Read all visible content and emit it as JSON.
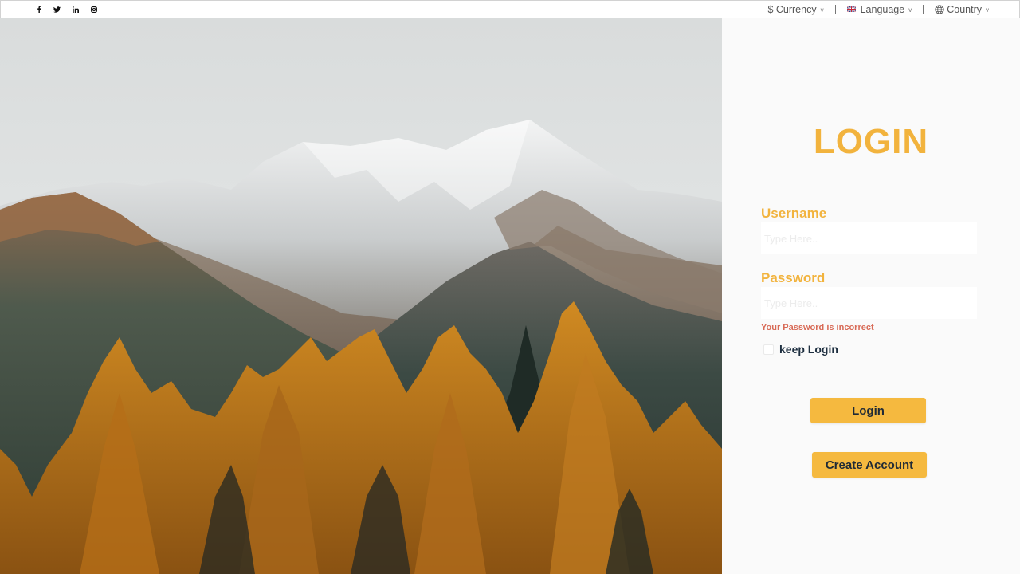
{
  "topbar": {
    "social": [
      {
        "name": "facebook-icon"
      },
      {
        "name": "twitter-icon"
      },
      {
        "name": "linkedin-icon"
      },
      {
        "name": "instagram-icon"
      }
    ],
    "currency_label": "$ Currency",
    "language_label": "Language",
    "country_label": "Country",
    "caret": "v"
  },
  "hero": {
    "image": "mountain-forest-photo"
  },
  "login": {
    "title": "LOGIN",
    "username_label": "Username",
    "username_placeholder": "Type Here..",
    "password_label": "Password",
    "password_placeholder": "Type Here..",
    "error": "Your Password is incorrect",
    "keep_label": "keep Login",
    "login_button": "Login",
    "create_button": "Create Account"
  },
  "colors": {
    "accent": "#f2b33d",
    "button": "#f5b93f",
    "error": "#d86a56",
    "text_dark": "#1e2f40"
  }
}
